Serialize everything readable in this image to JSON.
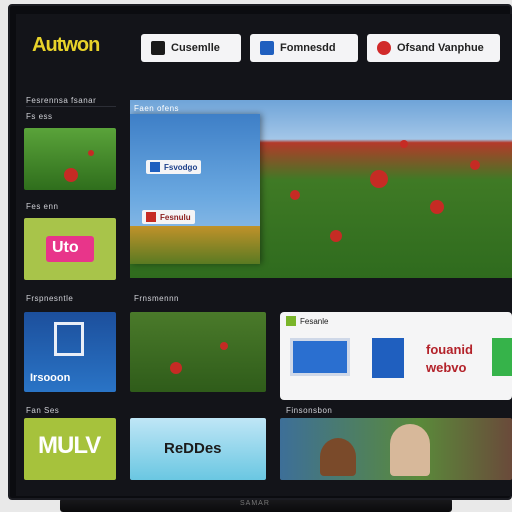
{
  "app": {
    "logo_text": "Autwon",
    "accent": "#e8d32a"
  },
  "nav": {
    "items": [
      {
        "label": "Cusemlle",
        "icon": "video-icon",
        "color": "#1a1a1a"
      },
      {
        "label": "Fomnesdd",
        "icon": "monitor-icon",
        "color": "#1f5fbf"
      },
      {
        "label": "Ofsand Vanphue",
        "icon": "record-icon",
        "color": "#d12a2a"
      }
    ]
  },
  "sections": {
    "top_left": "Fesrennsa fsanar",
    "top_left_sub": "Fs ess",
    "hero_caption": "Faen ofens",
    "row2_left": "Fes enn",
    "row3_left": "Frspnesntle",
    "row3_mid": "Frnsmennn",
    "row4_left": "Fan Ses",
    "row4_mid": "Finsonsbon"
  },
  "hero": {
    "badge1": "Fsvodgo",
    "badge2": "Fesnulu"
  },
  "tiles": {
    "pink_label": "Uto",
    "blue_label": "Irsooon",
    "mulv_label": "MULV",
    "teal_label": "ReDDes"
  },
  "promo": {
    "header": "Fesanle",
    "text_line1": "fouanid",
    "text_line2": "webvo"
  },
  "tv": {
    "brand": "SAMAR"
  }
}
